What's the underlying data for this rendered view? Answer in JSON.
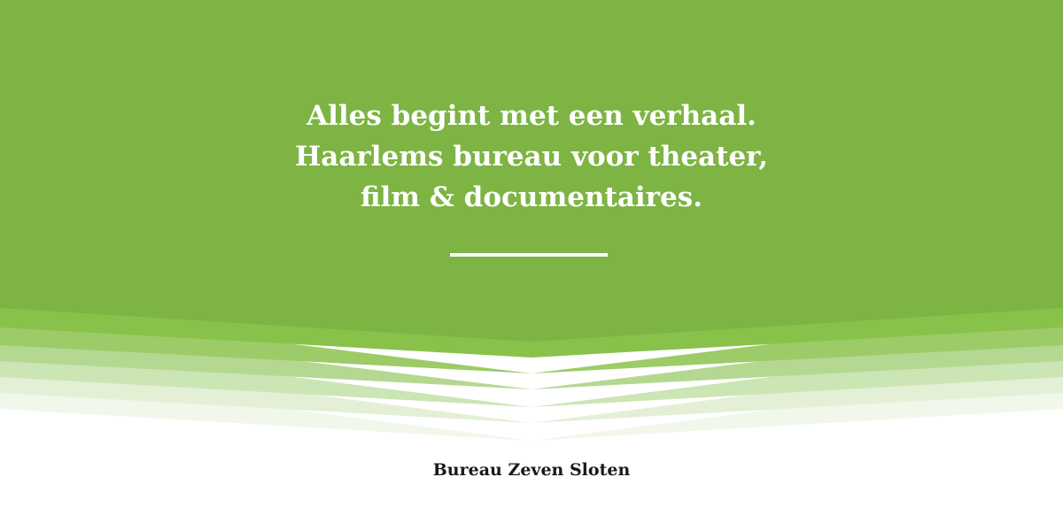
{
  "colors": {
    "primary_green": "#7db443",
    "band_1": "#89c24a",
    "band_2": "#9ccb68",
    "band_3": "#b4d891",
    "band_4": "#cce5b5",
    "band_5": "#e3f0d6",
    "band_6": "#f1f7ea",
    "text_light": "#ffffff",
    "text_dark": "#1a1a1a"
  },
  "hero": {
    "tagline_line_1": "Alles begint met een verhaal.",
    "tagline_line_2": "Haarlems bureau voor theater,",
    "tagline_line_3": "film & documentaires."
  },
  "footer": {
    "brand_name": "Bureau Zeven Sloten"
  }
}
